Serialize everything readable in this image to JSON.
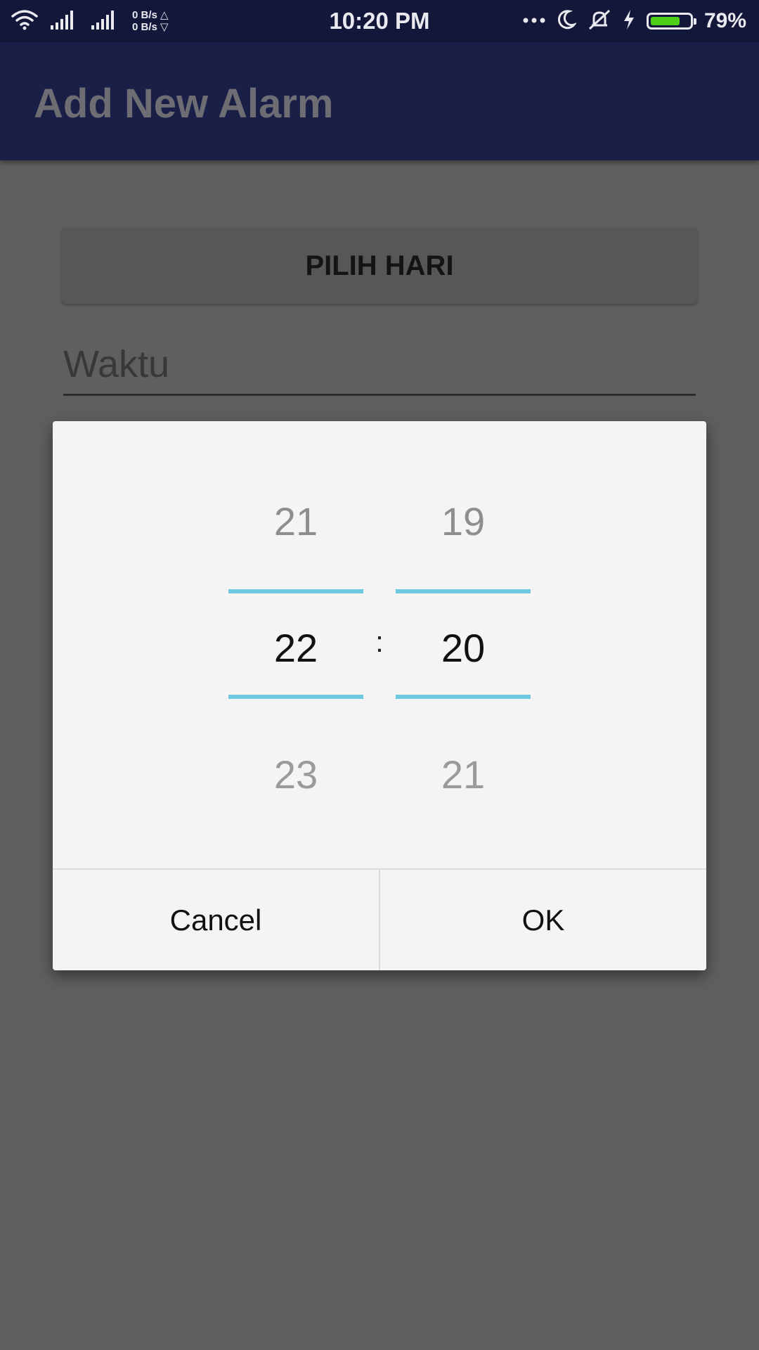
{
  "status_bar": {
    "time": "10:20 PM",
    "speed_up": "0 B/s",
    "speed_down": "0 B/s",
    "battery_percent": "79%",
    "battery_level": 0.79,
    "icons": [
      "wifi-icon",
      "signal-icon",
      "signal-icon",
      "more-icon",
      "moon-icon",
      "silent-icon",
      "charging-icon",
      "battery-icon"
    ]
  },
  "app_bar": {
    "title": "Add New Alarm"
  },
  "form": {
    "pilih_hari_label": "PILIH HARI",
    "waktu_placeholder": "Waktu"
  },
  "time_picker": {
    "hours": {
      "prev": "21",
      "current": "22",
      "next": "23"
    },
    "separator": ":",
    "minutes": {
      "prev": "19",
      "current": "20",
      "next": "21"
    },
    "accent_color": "#6fc8e0"
  },
  "dialog_actions": {
    "cancel_label": "Cancel",
    "ok_label": "OK"
  }
}
